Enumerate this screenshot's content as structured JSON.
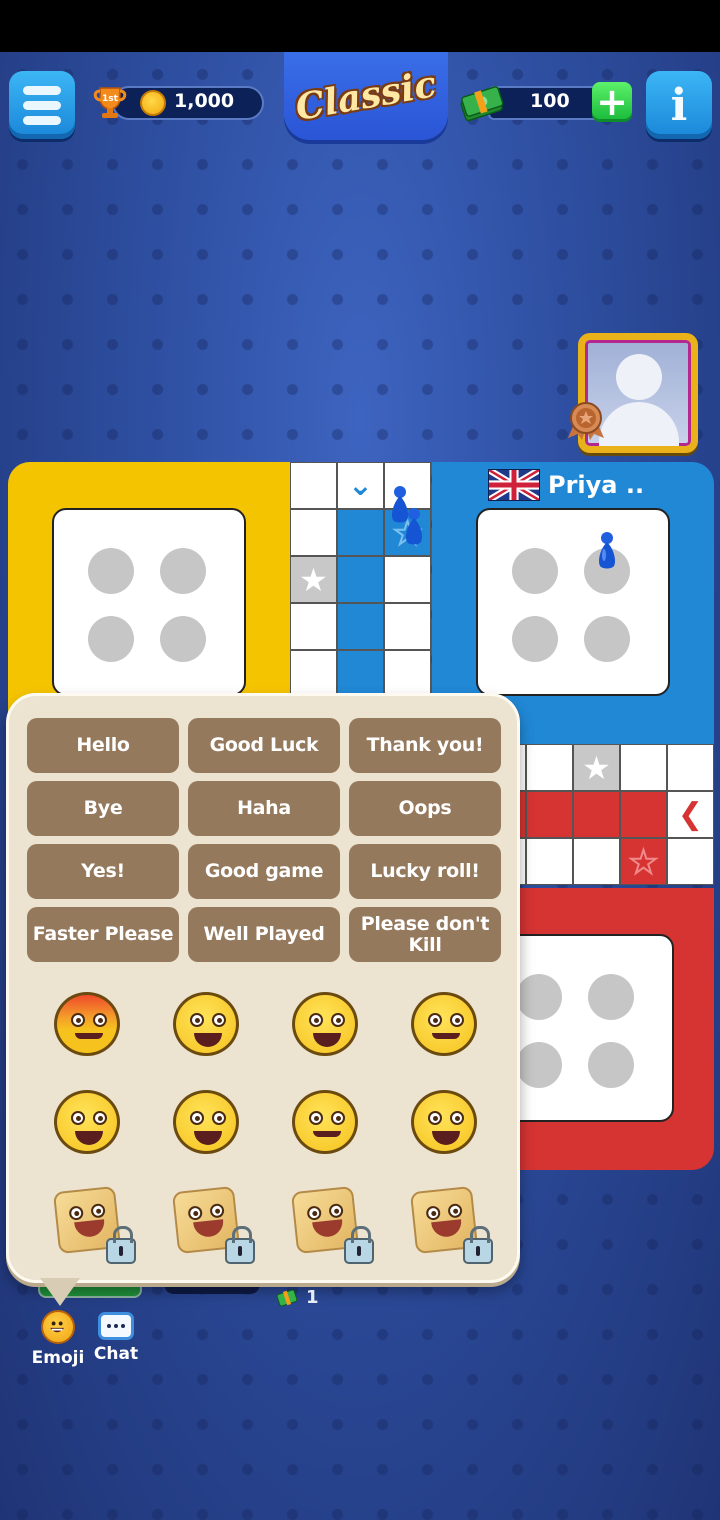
{
  "header": {
    "menu_icon": "hamburger-icon",
    "rank_badge": "1st",
    "coins": "1,000",
    "mode_title": "Classic",
    "cash": "100",
    "add_cash_icon": "plus-icon",
    "info_icon": "info-icon"
  },
  "opponent": {
    "name": "Priya ..",
    "flag": "united-kingdom",
    "avatar_icon": "default-avatar-icon",
    "badge_icon": "bronze-medal-icon"
  },
  "board": {
    "colors": {
      "yellow": "#f5c400",
      "blue": "#2188d6",
      "red": "#d63333",
      "safe_grey": "#c8c8c8"
    },
    "tokens_in_blue_home": 1,
    "tokens_on_track_blue": 2
  },
  "quick_chat": {
    "phrases": [
      "Hello",
      "Good Luck",
      "Thank you!",
      "Bye",
      "Haha",
      "Oops",
      "Yes!",
      "Good game",
      "Lucky roll!",
      "Faster Please",
      "Well Played",
      "Please don't Kill"
    ],
    "emojis": [
      {
        "name": "angry-emoji",
        "locked": false
      },
      {
        "name": "crying-laughing-emoji",
        "locked": false
      },
      {
        "name": "laughing-emoji",
        "locked": false
      },
      {
        "name": "winking-tongue-emoji",
        "locked": false
      },
      {
        "name": "yawning-emoji",
        "locked": false
      },
      {
        "name": "eye-roll-emoji",
        "locked": false
      },
      {
        "name": "nervous-emoji",
        "locked": false
      },
      {
        "name": "shocked-emoji",
        "locked": false
      },
      {
        "name": "cool-dice-sticker",
        "locked": true
      },
      {
        "name": "laughing-dice-sticker",
        "locked": true
      },
      {
        "name": "crying-dice-sticker",
        "locked": true
      },
      {
        "name": "turban-dice-sticker",
        "locked": true
      }
    ]
  },
  "bottom": {
    "reward_count": "1",
    "emoji_label": "Emoji",
    "chat_label": "Chat"
  }
}
